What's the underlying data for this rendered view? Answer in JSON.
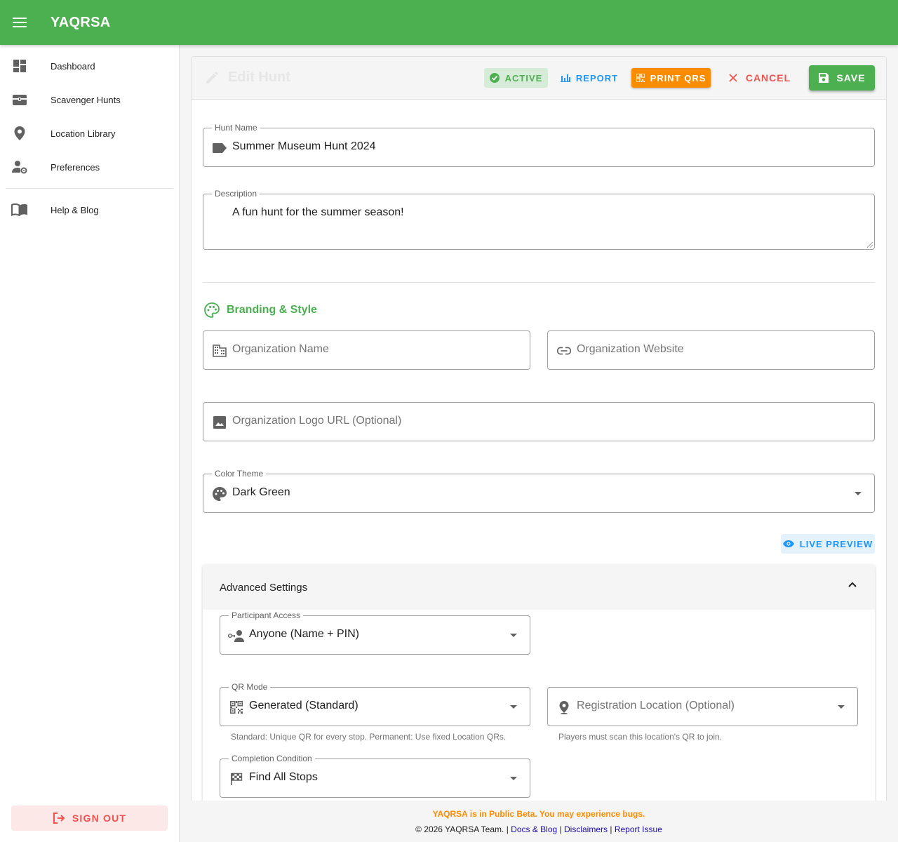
{
  "app": {
    "title": "YAQRSA"
  },
  "sidebar": {
    "items": [
      {
        "label": "Dashboard",
        "icon": "dashboard-icon"
      },
      {
        "label": "Scavenger Hunts",
        "icon": "treasure-chest-icon"
      },
      {
        "label": "Location Library",
        "icon": "location-pin-icon"
      },
      {
        "label": "Preferences",
        "icon": "user-settings-icon"
      },
      {
        "label": "Help & Blog",
        "icon": "book-icon"
      }
    ],
    "sign_out": "SIGN OUT"
  },
  "header": {
    "title": "Edit Hunt",
    "active": "ACTIVE",
    "report": "REPORT",
    "print_qrs": "PRINT QRS",
    "cancel": "CANCEL",
    "save": "SAVE"
  },
  "form": {
    "hunt_name": {
      "label": "Hunt Name",
      "value": "Summer Museum Hunt 2024"
    },
    "description": {
      "label": "Description",
      "value": "A fun hunt for the summer season!"
    },
    "branding": {
      "title": "Branding & Style",
      "org_name_placeholder": "Organization Name",
      "org_website_placeholder": "Organization Website",
      "org_logo_placeholder": "Organization Logo URL (Optional)",
      "color_theme": {
        "label": "Color Theme",
        "value": "Dark Green"
      }
    },
    "live_preview": "LIVE PREVIEW",
    "advanced": {
      "title": "Advanced Settings",
      "participant_access": {
        "label": "Participant Access",
        "value": "Anyone (Name + PIN)"
      },
      "qr_mode": {
        "label": "QR Mode",
        "value": "Generated (Standard)",
        "hint": "Standard: Unique QR for every stop. Permanent: Use fixed Location QRs."
      },
      "registration_location": {
        "placeholder": "Registration Location (Optional)",
        "hint": "Players must scan this location's QR to join."
      },
      "completion_condition": {
        "label": "Completion Condition",
        "value": "Find All Stops"
      }
    }
  },
  "footer": {
    "beta": "YAQRSA is in Public Beta. You may experience bugs.",
    "copyright": "© 2026 YAQRSA Team. |",
    "links": [
      "Docs & Blog",
      "Disclaimers",
      "Report Issue"
    ],
    "separator": "|"
  },
  "colors": {
    "primary": "#4caf50",
    "accent_blue": "#2196f3",
    "warning_orange": "#fb8c00",
    "danger_red": "#ef5350"
  }
}
